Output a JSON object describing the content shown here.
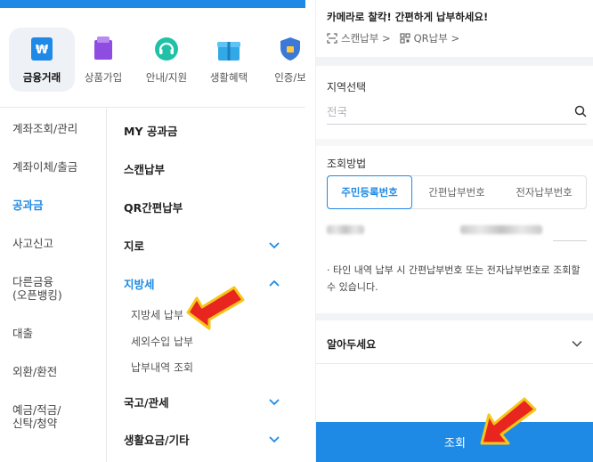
{
  "left": {
    "categories": [
      {
        "label": "금융거래",
        "icon": "won-card-icon"
      },
      {
        "label": "상품가입",
        "icon": "shopping-bag-icon"
      },
      {
        "label": "안내/지원",
        "icon": "headset-icon"
      },
      {
        "label": "생활혜택",
        "icon": "gift-icon"
      },
      {
        "label": "인증/보",
        "icon": "shield-icon"
      }
    ],
    "menu": [
      "계좌조회/관리",
      "계좌이체/출금",
      "공과금",
      "사고신고",
      "다른금융\n(오픈뱅킹)",
      "대출",
      "외환/환전",
      "예금/적금/\n신탁/청약"
    ],
    "submenu": [
      {
        "label": "MY 공과금"
      },
      {
        "label": "스캔납부"
      },
      {
        "label": "QR간편납부"
      },
      {
        "label": "지로"
      },
      {
        "label": "지방세"
      },
      {
        "label": "국고/관세"
      },
      {
        "label": "생활요금/기타"
      }
    ],
    "local_tax_items": [
      "지방세 납부",
      "세외수입 납부",
      "납부내역 조회"
    ]
  },
  "right": {
    "banner_title": "카메라로 찰칵! 간편하게 납부하세요!",
    "scan_link": "스캔납부 >",
    "qr_link": "QR납부 >",
    "region_label": "지역선택",
    "region_placeholder": "전국",
    "method_label": "조회방법",
    "tabs": [
      "주민등록번호",
      "간편납부번호",
      "전자납부번호"
    ],
    "notice": "타인 내역 납부 시 간편납부번호 또는 전자납부번호로 조회할 수 있습니다.",
    "notice_bullet": "·",
    "know_label": "알아두세요",
    "submit_label": "조회"
  },
  "colors": {
    "accent": "#1e8ae6",
    "arrow_red": "#e8261f",
    "arrow_yellow": "#f6c619"
  }
}
